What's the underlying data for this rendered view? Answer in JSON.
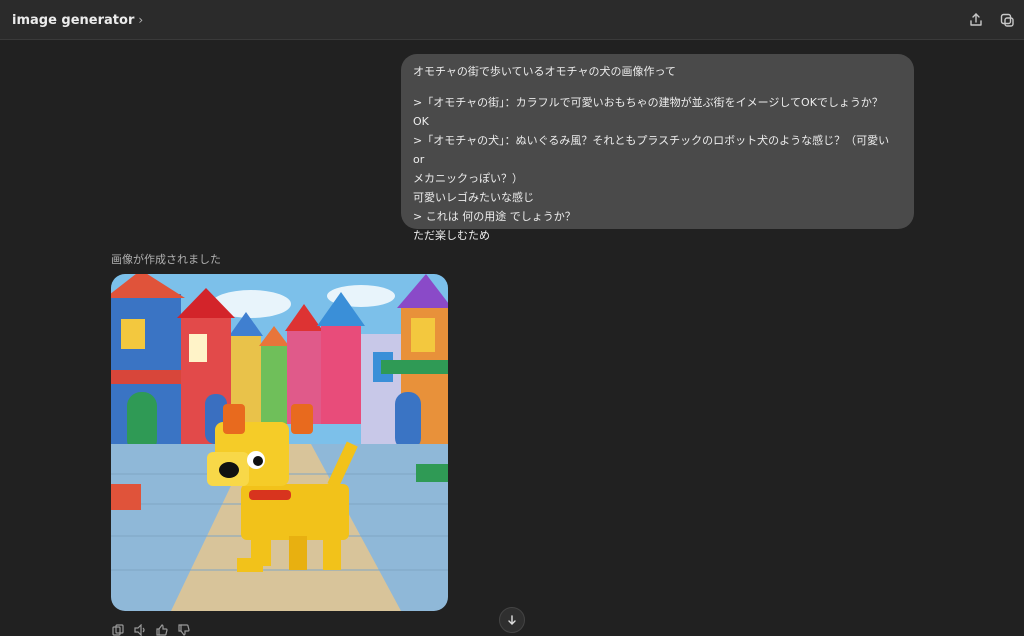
{
  "header": {
    "title": "image generator",
    "chevron_icon": "chevron-right-icon",
    "share_icon": "share-icon",
    "new_chat_icon": "new-chat-icon"
  },
  "conversation": {
    "user_message": {
      "lines": [
        "オモチャの街で歩いているオモチャの犬の画像作って",
        ">「オモチャの街」：カラフルで可愛いおもちゃの建物が並ぶ街をイメージしてOKでしょうか？",
        "OK",
        ">「オモチャの犬」：ぬいぐるみ風？それともプラスチックのロボット犬のような感じ？（可愛い or",
        "メカニックっぽい？）",
        "可愛いレゴみたいな感じ",
        "> これは 何の用途 でしょうか？",
        "ただ楽しむため"
      ]
    },
    "assistant": {
      "status": "画像が作成されました",
      "image_alt": "toy dog in toy town",
      "actions": [
        "copy-icon",
        "speaker-icon",
        "thumbs-up-icon",
        "thumbs-down-icon"
      ]
    }
  },
  "scroll_icon": "arrow-down-icon",
  "colors": {
    "background": "#212121",
    "header": "#2b2b2b",
    "bubble": "#4a4a4a",
    "text": "#ececec",
    "muted": "#b0b0b0"
  }
}
